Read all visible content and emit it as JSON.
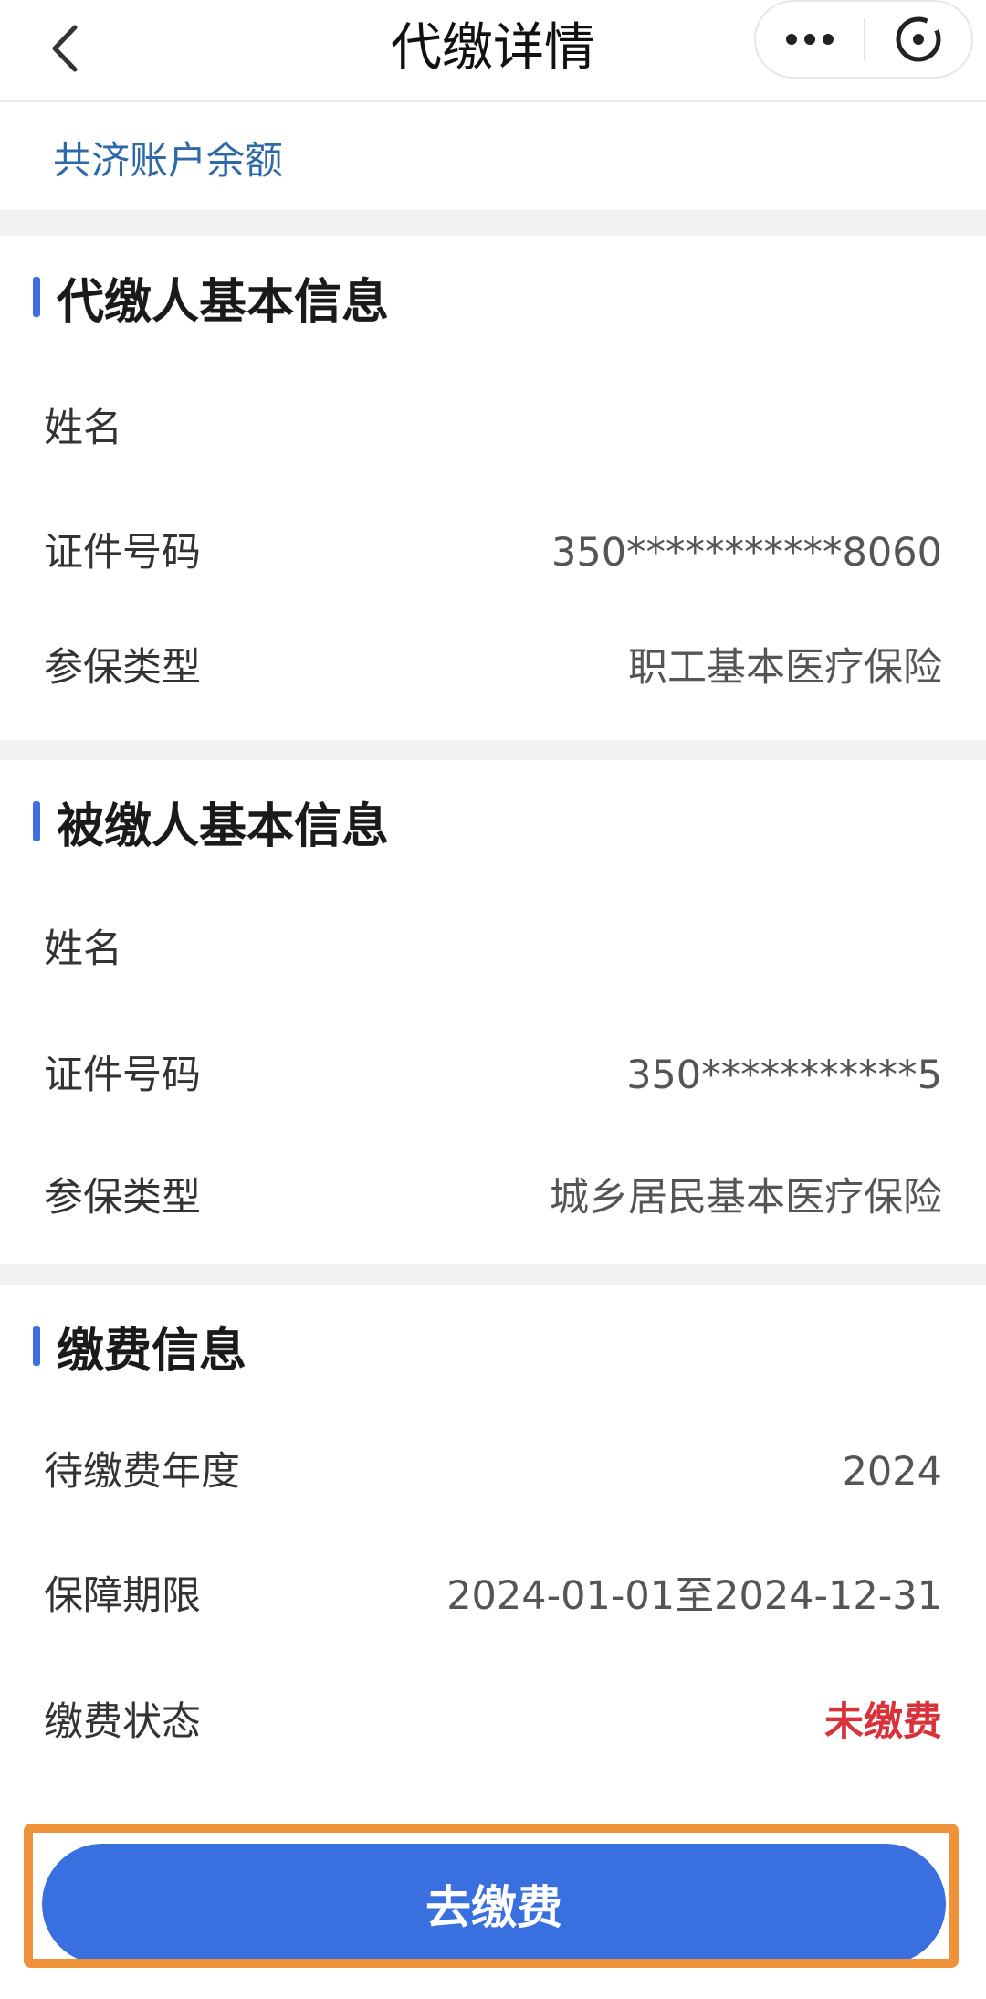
{
  "nav": {
    "title": "代缴详情"
  },
  "balance": {
    "label": "共济账户余额",
    "value": ""
  },
  "payer": {
    "section_title": "代缴人基本信息",
    "rows": [
      {
        "label": "姓名",
        "value": ""
      },
      {
        "label": "证件号码",
        "value": "350***********8060"
      },
      {
        "label": "参保类型",
        "value": "职工基本医疗保险"
      }
    ]
  },
  "insured": {
    "section_title": "被缴人基本信息",
    "rows": [
      {
        "label": "姓名",
        "value": ""
      },
      {
        "label": "证件号码",
        "value": "350***********5"
      },
      {
        "label": "参保类型",
        "value": "城乡居民基本医疗保险"
      }
    ]
  },
  "payment": {
    "section_title": "缴费信息",
    "rows": [
      {
        "label": "待缴费年度",
        "value": "2024"
      },
      {
        "label": "保障期限",
        "value": "2024-01-01至2024-12-31"
      },
      {
        "label": "缴费状态",
        "value": "未缴费"
      }
    ]
  },
  "action": {
    "pay_label": "去缴费"
  },
  "colors": {
    "accent": "#3a6fe0",
    "unpaid": "#d9323a",
    "highlight": "#f0923a",
    "balance_text": "#2f6aa8"
  },
  "icons": [
    "back-arrow-icon",
    "more-dots-icon",
    "close-circle-icon"
  ]
}
